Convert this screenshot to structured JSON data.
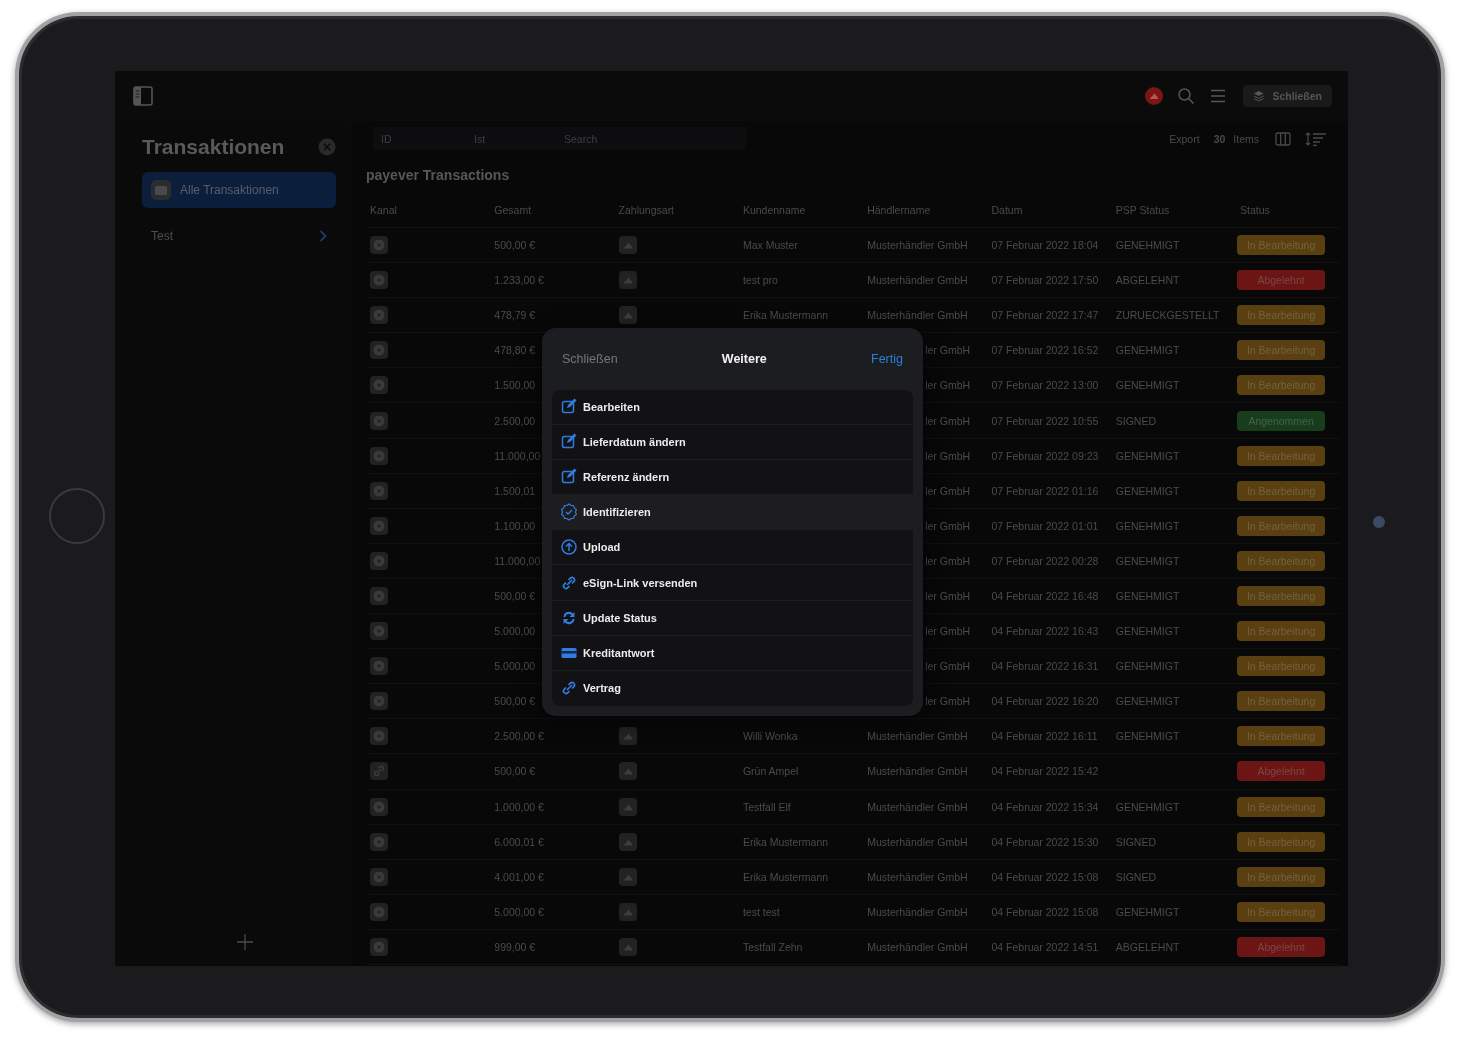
{
  "top_bar": {
    "button": "Schließen"
  },
  "sidebar": {
    "title": "Transaktionen",
    "items": [
      {
        "label": "Alle Transaktionen",
        "selected": true
      },
      {
        "label": "Test",
        "selected": false
      }
    ]
  },
  "toolbar": {
    "filters": [
      {
        "placeholder": "ID"
      },
      {
        "placeholder": "Ist"
      },
      {
        "placeholder": "Search"
      }
    ],
    "export": "Export",
    "count": "30",
    "count_label": "Items"
  },
  "table": {
    "title": "payever Transactions",
    "columns": [
      "Kanal",
      "Gesamt",
      "Zahlungsart",
      "Kundenname",
      "Händlername",
      "Datum",
      "PSP Status",
      "Status"
    ],
    "rows": [
      {
        "kind": "full",
        "channel": {
          "kind": "disc"
        },
        "total": "500,00 €",
        "customer": "Max Muster",
        "merchant": "Musterhändler GmbH",
        "date": "07 Februar 2022 18:04",
        "psp_status": "GENEHMIGT",
        "status": {
          "label": "In Bearbeitung",
          "color": "#5a3f10"
        }
      },
      {
        "kind": "full",
        "channel": {
          "kind": "disc"
        },
        "total": "1.233,00 €",
        "customer": "test pro",
        "merchant": "Musterhändler GmbH",
        "date": "07 Februar 2022 17:50",
        "psp_status": "ABGELEHNT",
        "status": {
          "label": "Abgelehnt",
          "color": "#6b1515"
        }
      },
      {
        "kind": "full",
        "channel": {
          "kind": "disc"
        },
        "total": "478,79 €",
        "customer": "Erika Mustermann",
        "merchant": "Musterhändler GmbH",
        "date": "07 Februar 2022 17:47",
        "psp_status": "ZURUECKGESTELLT",
        "status": {
          "label": "In Bearbeitung",
          "color": "#5a3f10"
        }
      },
      {
        "kind": "covered",
        "channel": {
          "kind": "disc"
        },
        "total": "478,80 €",
        "merchant": "ler GmbH",
        "date": "07 Februar 2022 16:52",
        "psp_status": "GENEHMIGT",
        "status": {
          "label": "In Bearbeitung",
          "color": "#5a3f10"
        }
      },
      {
        "kind": "covered",
        "channel": {
          "kind": "disc"
        },
        "total": "1.500,00",
        "merchant": "ler GmbH",
        "date": "07 Februar 2022 13:00",
        "psp_status": "GENEHMIGT",
        "status": {
          "label": "In Bearbeitung",
          "color": "#5a3f10"
        }
      },
      {
        "kind": "covered",
        "channel": {
          "kind": "disc"
        },
        "total": "2.500,00",
        "merchant": "ler GmbH",
        "date": "07 Februar 2022 10:55",
        "psp_status": "SIGNED",
        "status": {
          "label": "Angenommen",
          "color": "#173d1c"
        }
      },
      {
        "kind": "covered",
        "channel": {
          "kind": "disc"
        },
        "total": "11.000,00",
        "merchant": "ler GmbH",
        "date": "07 Februar 2022 09:23",
        "psp_status": "GENEHMIGT",
        "status": {
          "label": "In Bearbeitung",
          "color": "#5a3f10"
        }
      },
      {
        "kind": "covered",
        "channel": {
          "kind": "disc"
        },
        "total": "1.500,01",
        "merchant": "ler GmbH",
        "date": "07 Februar 2022 01:16",
        "psp_status": "GENEHMIGT",
        "status": {
          "label": "In Bearbeitung",
          "color": "#5a3f10"
        }
      },
      {
        "kind": "covered",
        "channel": {
          "kind": "disc"
        },
        "total": "1.100,00",
        "merchant": "ler GmbH",
        "date": "07 Februar 2022 01:01",
        "psp_status": "GENEHMIGT",
        "status": {
          "label": "In Bearbeitung",
          "color": "#5a3f10"
        }
      },
      {
        "kind": "covered",
        "channel": {
          "kind": "disc"
        },
        "total": "11.000,00",
        "merchant": "ler GmbH",
        "date": "07 Februar 2022 00:28",
        "psp_status": "GENEHMIGT",
        "status": {
          "label": "In Bearbeitung",
          "color": "#5a3f10"
        }
      },
      {
        "kind": "covered",
        "channel": {
          "kind": "disc"
        },
        "total": "500,00 €",
        "merchant": "ler GmbH",
        "date": "04 Februar 2022 16:48",
        "psp_status": "GENEHMIGT",
        "status": {
          "label": "In Bearbeitung",
          "color": "#5a3f10"
        }
      },
      {
        "kind": "covered",
        "channel": {
          "kind": "disc"
        },
        "total": "5.000,00",
        "merchant": "ler GmbH",
        "date": "04 Februar 2022 16:43",
        "psp_status": "GENEHMIGT",
        "status": {
          "label": "In Bearbeitung",
          "color": "#5a3f10"
        }
      },
      {
        "kind": "covered",
        "channel": {
          "kind": "disc"
        },
        "total": "5.000,00",
        "merchant": "ler GmbH",
        "date": "04 Februar 2022 16:31",
        "psp_status": "GENEHMIGT",
        "status": {
          "label": "In Bearbeitung",
          "color": "#5a3f10"
        }
      },
      {
        "kind": "covered",
        "channel": {
          "kind": "disc"
        },
        "total": "500,00 €",
        "merchant": "ler GmbH",
        "date": "04 Februar 2022 16:20",
        "psp_status": "GENEHMIGT",
        "status": {
          "label": "In Bearbeitung",
          "color": "#5a3f10"
        }
      },
      {
        "kind": "full",
        "channel": {
          "kind": "disc"
        },
        "total": "2.500,00 €",
        "customer": "Willi Wonka",
        "merchant": "Musterhändler GmbH",
        "date": "04 Februar 2022 16:11",
        "psp_status": "GENEHMIGT",
        "status": {
          "label": "In Bearbeitung",
          "color": "#5a3f10"
        }
      },
      {
        "kind": "full",
        "channel": {
          "kind": "link"
        },
        "total": "500,00 €",
        "customer": "Grün Ampel",
        "merchant": "Musterhändler GmbH",
        "date": "04 Februar 2022 15:42",
        "status": {
          "label": "Abgelehnt",
          "color": "#6b1515"
        }
      },
      {
        "kind": "full",
        "channel": {
          "kind": "disc"
        },
        "total": "1.000,00 €",
        "customer": "Testfall Elf",
        "merchant": "Musterhändler GmbH",
        "date": "04 Februar 2022 15:34",
        "psp_status": "GENEHMIGT",
        "status": {
          "label": "In Bearbeitung",
          "color": "#5a3f10"
        }
      },
      {
        "kind": "full",
        "channel": {
          "kind": "disc"
        },
        "total": "6.000,01 €",
        "customer": "Erika Mustermann",
        "merchant": "Musterhändler GmbH",
        "date": "04 Februar 2022 15:30",
        "psp_status": "SIGNED",
        "status": {
          "label": "In Bearbeitung",
          "color": "#5a3f10"
        }
      },
      {
        "kind": "full",
        "channel": {
          "kind": "disc"
        },
        "total": "4.001,00 €",
        "customer": "Erika Mustermann",
        "merchant": "Musterhändler GmbH",
        "date": "04 Februar 2022 15:08",
        "psp_status": "SIGNED",
        "status": {
          "label": "In Bearbeitung",
          "color": "#5a3f10"
        }
      },
      {
        "kind": "full",
        "channel": {
          "kind": "disc"
        },
        "total": "5.000,00 €",
        "customer": "test test",
        "merchant": "Musterhändler GmbH",
        "date": "04 Februar 2022 15:08",
        "psp_status": "GENEHMIGT",
        "status": {
          "label": "In Bearbeitung",
          "color": "#5a3f10"
        }
      },
      {
        "kind": "full",
        "channel": {
          "kind": "disc"
        },
        "total": "999,00 €",
        "customer": "Testfall Zehn",
        "merchant": "Musterhändler GmbH",
        "date": "04 Februar 2022 14:51",
        "psp_status": "ABGELEHNT",
        "status": {
          "label": "Abgelehnt",
          "color": "#6b1515"
        }
      }
    ]
  },
  "sheet": {
    "cancel": "Schließen",
    "title": "Weitere",
    "done": "Fertig",
    "items": [
      {
        "kind": "edit",
        "label": "Bearbeiten",
        "selected": false
      },
      {
        "kind": "edit",
        "label": "Lieferdatum ändern",
        "selected": false
      },
      {
        "kind": "edit",
        "label": "Referenz ändern",
        "selected": false
      },
      {
        "kind": "verify",
        "label": "Identifizieren",
        "selected": true
      },
      {
        "kind": "upload",
        "label": "Upload",
        "selected": false
      },
      {
        "kind": "link",
        "label": "eSign-Link versenden",
        "selected": false
      },
      {
        "kind": "sync",
        "label": "Update Status",
        "selected": false
      },
      {
        "kind": "card",
        "label": "Kreditantwort",
        "selected": false
      },
      {
        "kind": "link",
        "label": "Vertrag",
        "selected": false
      }
    ]
  }
}
